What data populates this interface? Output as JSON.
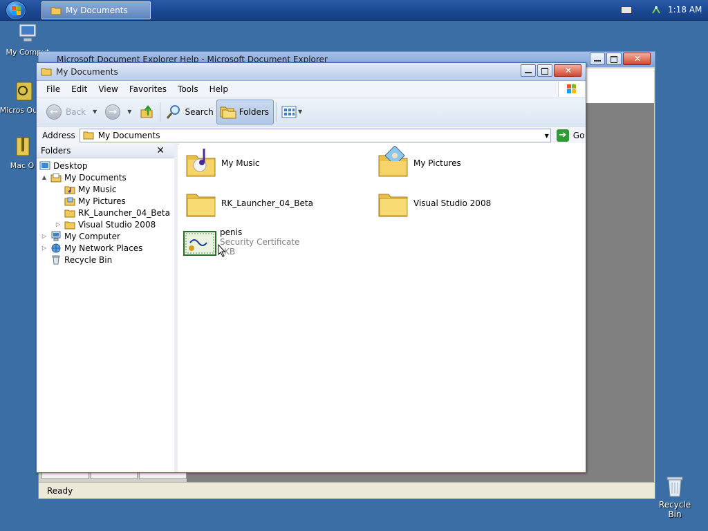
{
  "taskbar": {
    "active_task": "My Documents",
    "clock": "1:18 AM"
  },
  "desktop": {
    "icons": [
      {
        "label": "My Comput"
      },
      {
        "label": "Micros Outlo"
      },
      {
        "label": "Mac O"
      }
    ],
    "recycle_bin": "Recycle Bin"
  },
  "background_window": {
    "title": "Microsoft Document Explorer Help - Microsoft Document Explorer",
    "status": "Ready"
  },
  "window": {
    "title": "My Documents",
    "menu": [
      "File",
      "Edit",
      "View",
      "Favorites",
      "Tools",
      "Help"
    ],
    "toolbar": {
      "back": "Back",
      "search": "Search",
      "folders": "Folders"
    },
    "address": {
      "label": "Address",
      "value": "My Documents",
      "go": "Go"
    },
    "folders_pane": {
      "title": "Folders",
      "tree": [
        {
          "label": "Desktop",
          "level": 0,
          "expander": ""
        },
        {
          "label": "My Documents",
          "level": 1,
          "expander": "▲"
        },
        {
          "label": "My Music",
          "level": 2,
          "expander": ""
        },
        {
          "label": "My Pictures",
          "level": 2,
          "expander": ""
        },
        {
          "label": "RK_Launcher_04_Beta",
          "level": 2,
          "expander": ""
        },
        {
          "label": "Visual Studio 2008",
          "level": 2,
          "expander": "▷"
        },
        {
          "label": "My Computer",
          "level": 1,
          "expander": "▷"
        },
        {
          "label": "My Network Places",
          "level": 1,
          "expander": "▷"
        },
        {
          "label": "Recycle Bin",
          "level": 1,
          "expander": ""
        }
      ]
    },
    "files": [
      {
        "name": "My Music"
      },
      {
        "name": "My Pictures"
      },
      {
        "name": "RK_Launcher_04_Beta"
      },
      {
        "name": "Visual Studio 2008"
      },
      {
        "name": "penis",
        "type": "Security Certificate",
        "size": "KB"
      }
    ]
  },
  "colors": {
    "desktop": "#3a6ea5",
    "taskbar": "#1d4a94",
    "folder": "#f2ca5a"
  }
}
